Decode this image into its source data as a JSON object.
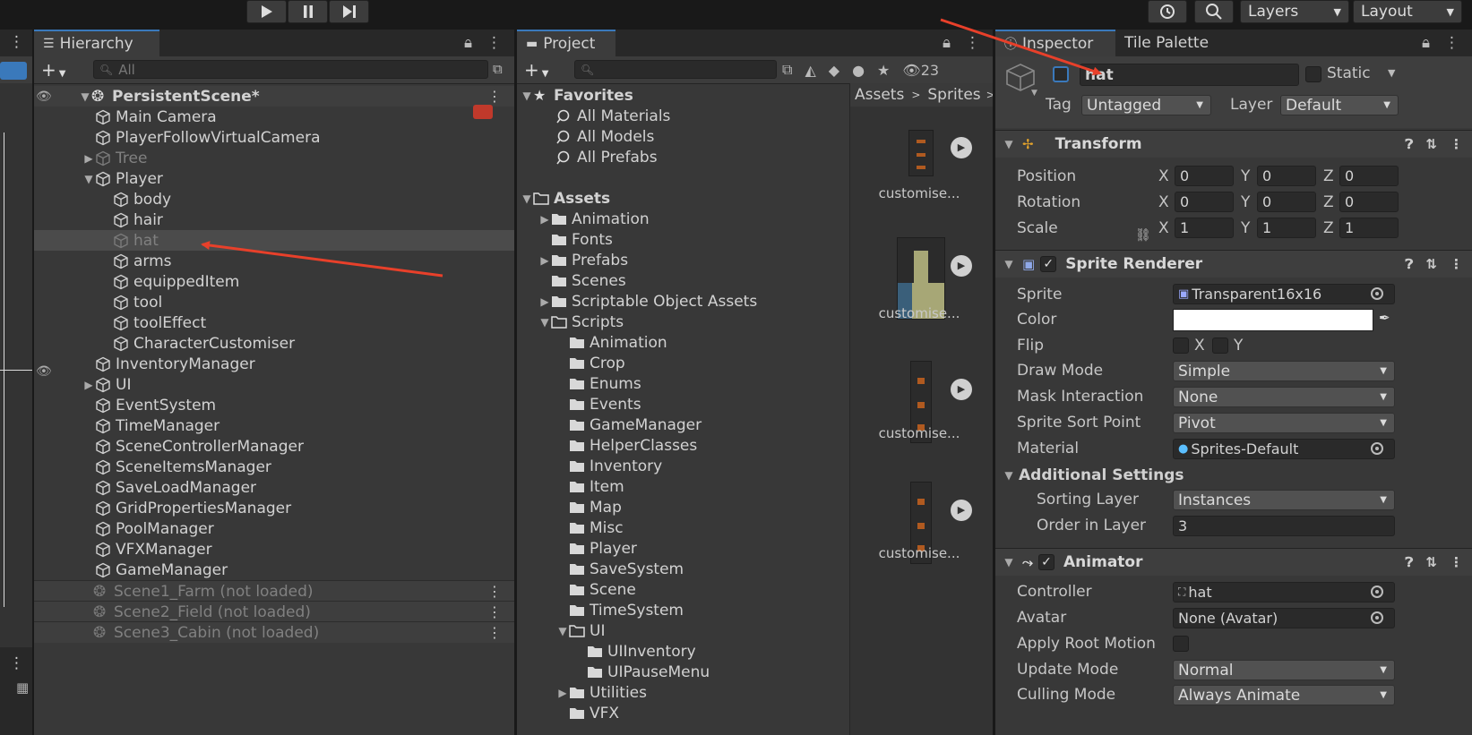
{
  "toolbar": {
    "layers_label": "Layers",
    "layout_label": "Layout"
  },
  "hierarchy": {
    "tab_label": "Hierarchy",
    "search_placeholder": "All",
    "scene_name": "PersistentScene*",
    "items": [
      {
        "label": "Main Camera",
        "depth": 0,
        "arrow": "",
        "dim": false
      },
      {
        "label": "PlayerFollowVirtualCamera",
        "depth": 0,
        "arrow": "",
        "dim": false
      },
      {
        "label": "Tree",
        "depth": 0,
        "arrow": "collapsed",
        "dim": true
      },
      {
        "label": "Player",
        "depth": 0,
        "arrow": "expanded",
        "dim": false
      },
      {
        "label": "body",
        "depth": 1,
        "arrow": "",
        "dim": false
      },
      {
        "label": "hair",
        "depth": 1,
        "arrow": "",
        "dim": false
      },
      {
        "label": "hat",
        "depth": 1,
        "arrow": "",
        "dim": true,
        "selected": true
      },
      {
        "label": "arms",
        "depth": 1,
        "arrow": "",
        "dim": false
      },
      {
        "label": "equippedItem",
        "depth": 1,
        "arrow": "",
        "dim": false
      },
      {
        "label": "tool",
        "depth": 1,
        "arrow": "",
        "dim": false
      },
      {
        "label": "toolEffect",
        "depth": 1,
        "arrow": "",
        "dim": false
      },
      {
        "label": "CharacterCustomiser",
        "depth": 1,
        "arrow": "",
        "dim": false
      },
      {
        "label": "InventoryManager",
        "depth": 0,
        "arrow": "",
        "dim": false
      },
      {
        "label": "UI",
        "depth": 0,
        "arrow": "collapsed",
        "dim": false
      },
      {
        "label": "EventSystem",
        "depth": 0,
        "arrow": "",
        "dim": false
      },
      {
        "label": "TimeManager",
        "depth": 0,
        "arrow": "",
        "dim": false
      },
      {
        "label": "SceneControllerManager",
        "depth": 0,
        "arrow": "",
        "dim": false
      },
      {
        "label": "SceneItemsManager",
        "depth": 0,
        "arrow": "",
        "dim": false
      },
      {
        "label": "SaveLoadManager",
        "depth": 0,
        "arrow": "",
        "dim": false
      },
      {
        "label": "GridPropertiesManager",
        "depth": 0,
        "arrow": "",
        "dim": false
      },
      {
        "label": "PoolManager",
        "depth": 0,
        "arrow": "",
        "dim": false
      },
      {
        "label": "VFXManager",
        "depth": 0,
        "arrow": "",
        "dim": false
      },
      {
        "label": "GameManager",
        "depth": 0,
        "arrow": "",
        "dim": false
      }
    ],
    "unloaded_scenes": [
      "Scene1_Farm (not loaded)",
      "Scene2_Field (not loaded)",
      "Scene3_Cabin (not loaded)"
    ]
  },
  "project": {
    "tab_label": "Project",
    "visible_count": "23",
    "favorites_label": "Favorites",
    "favorites": [
      "All Materials",
      "All Models",
      "All Prefabs"
    ],
    "assets_label": "Assets",
    "folders": [
      {
        "label": "Animation",
        "depth": 1,
        "arrow": "collapsed",
        "open": false
      },
      {
        "label": "Fonts",
        "depth": 1,
        "arrow": "",
        "open": false
      },
      {
        "label": "Prefabs",
        "depth": 1,
        "arrow": "collapsed",
        "open": false
      },
      {
        "label": "Scenes",
        "depth": 1,
        "arrow": "",
        "open": false
      },
      {
        "label": "Scriptable Object Assets",
        "depth": 1,
        "arrow": "collapsed",
        "open": false
      },
      {
        "label": "Scripts",
        "depth": 1,
        "arrow": "expanded",
        "open": true
      },
      {
        "label": "Animation",
        "depth": 2,
        "arrow": "",
        "open": false
      },
      {
        "label": "Crop",
        "depth": 2,
        "arrow": "",
        "open": false
      },
      {
        "label": "Enums",
        "depth": 2,
        "arrow": "",
        "open": false
      },
      {
        "label": "Events",
        "depth": 2,
        "arrow": "",
        "open": false
      },
      {
        "label": "GameManager",
        "depth": 2,
        "arrow": "",
        "open": false
      },
      {
        "label": "HelperClasses",
        "depth": 2,
        "arrow": "",
        "open": false
      },
      {
        "label": "Inventory",
        "depth": 2,
        "arrow": "",
        "open": false
      },
      {
        "label": "Item",
        "depth": 2,
        "arrow": "",
        "open": false
      },
      {
        "label": "Map",
        "depth": 2,
        "arrow": "",
        "open": false
      },
      {
        "label": "Misc",
        "depth": 2,
        "arrow": "",
        "open": false
      },
      {
        "label": "Player",
        "depth": 2,
        "arrow": "",
        "open": false
      },
      {
        "label": "SaveSystem",
        "depth": 2,
        "arrow": "",
        "open": false
      },
      {
        "label": "Scene",
        "depth": 2,
        "arrow": "",
        "open": false
      },
      {
        "label": "TimeSystem",
        "depth": 2,
        "arrow": "",
        "open": false
      },
      {
        "label": "UI",
        "depth": 2,
        "arrow": "expanded",
        "open": true
      },
      {
        "label": "UIInventory",
        "depth": 3,
        "arrow": "",
        "open": false
      },
      {
        "label": "UIPauseMenu",
        "depth": 3,
        "arrow": "",
        "open": false
      },
      {
        "label": "Utilities",
        "depth": 2,
        "arrow": "collapsed",
        "open": false
      },
      {
        "label": "VFX",
        "depth": 2,
        "arrow": "",
        "open": false
      }
    ],
    "breadcrumb": [
      "Assets",
      "Sprites"
    ],
    "assets": [
      "customise...",
      "customise...",
      "customise...",
      "customise..."
    ]
  },
  "inspector": {
    "tab_label": "Inspector",
    "tab2_label": "Tile Palette",
    "object_name": "hat",
    "static_label": "Static",
    "tag_label": "Tag",
    "tag_value": "Untagged",
    "layer_label": "Layer",
    "layer_value": "Default",
    "transform": {
      "title": "Transform",
      "position_label": "Position",
      "rotation_label": "Rotation",
      "scale_label": "Scale",
      "position": [
        "0",
        "0",
        "0"
      ],
      "rotation": [
        "0",
        "0",
        "0"
      ],
      "scale": [
        "1",
        "1",
        "1"
      ],
      "axis_x": "X",
      "axis_y": "Y",
      "axis_z": "Z"
    },
    "sprite_renderer": {
      "title": "Sprite Renderer",
      "sprite_label": "Sprite",
      "sprite_value": "Transparent16x16",
      "color_label": "Color",
      "color_value": "#ffffff",
      "flip_label": "Flip",
      "flip_x": "X",
      "flip_y": "Y",
      "draw_mode_label": "Draw Mode",
      "draw_mode_value": "Simple",
      "mask_label": "Mask Interaction",
      "mask_value": "None",
      "sort_point_label": "Sprite Sort Point",
      "sort_point_value": "Pivot",
      "material_label": "Material",
      "material_value": "Sprites-Default",
      "additional_label": "Additional Settings",
      "sorting_layer_label": "Sorting Layer",
      "sorting_layer_value": "Instances",
      "order_label": "Order in Layer",
      "order_value": "3"
    },
    "animator": {
      "title": "Animator",
      "controller_label": "Controller",
      "controller_value": "hat",
      "avatar_label": "Avatar",
      "avatar_value": "None (Avatar)",
      "root_motion_label": "Apply Root Motion",
      "update_mode_label": "Update Mode",
      "update_mode_value": "Normal",
      "culling_label": "Culling Mode",
      "culling_value": "Always Animate"
    }
  },
  "colors": {
    "annotation_arrow": "#e8402a",
    "selection": "#4b4b4b",
    "accent": "#3a79bb"
  }
}
